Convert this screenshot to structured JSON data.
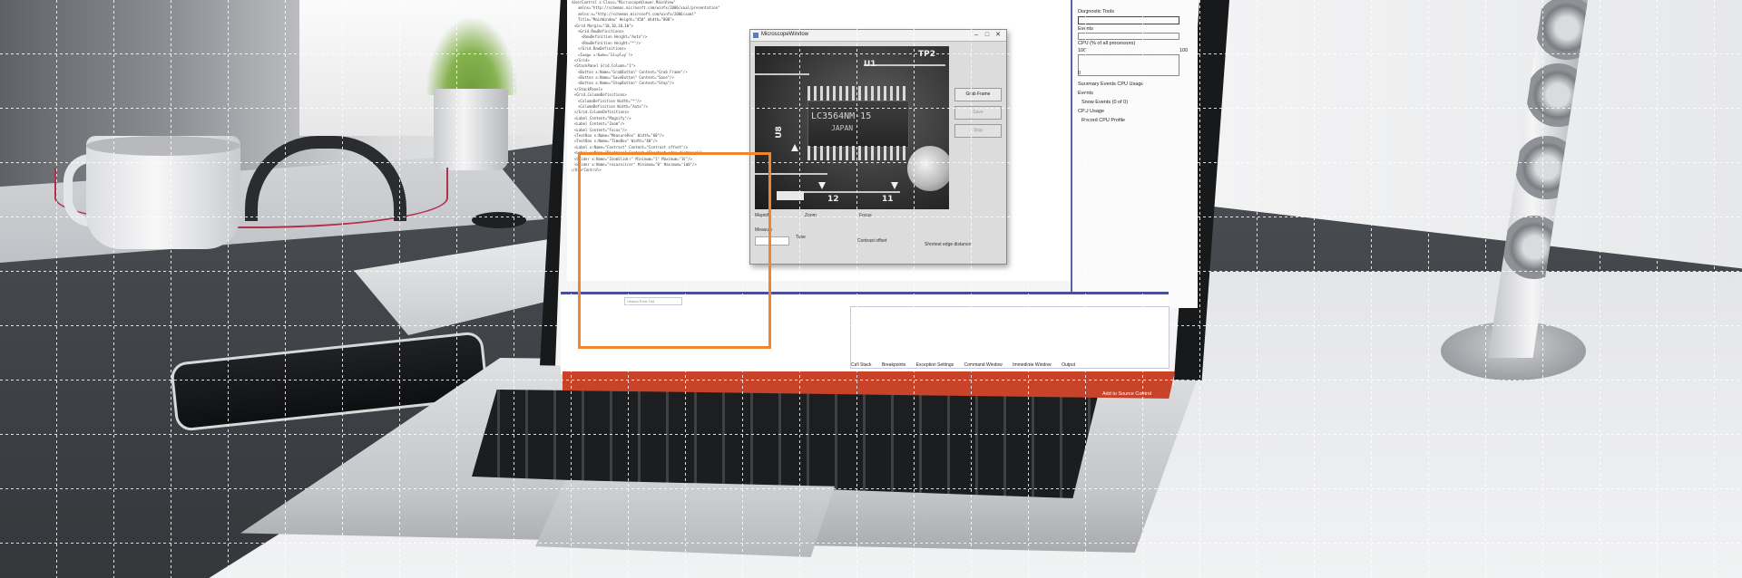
{
  "app_window": {
    "title": "MicroscopeWindow",
    "buttons": {
      "primary": "Grab Frame",
      "secondary": "Save",
      "tertiary": "Stop"
    },
    "labels": {
      "magnify": "Magnify",
      "zoom": "Zoom",
      "focus": "Focus",
      "measure": "Measure",
      "time": "Time",
      "contrast": "Contrast offset",
      "distance": "Shortest edge distance"
    }
  },
  "board_markings": {
    "chip_part": "LC3564NM-15",
    "chip_origin": "JAPAN",
    "tp2": "TP2",
    "ufl": "U8",
    "u3": "U1",
    "label_12": "12",
    "label_11": "11"
  },
  "ide": {
    "code_lines": [
      "<UserControl x:Class=\"MicroscopeViewer.MainView\"",
      "    xmlns=\"http://schemas.microsoft.com/winfx/2006/xaml/presentation\"",
      "    xmlns:x=\"http://schemas.microsoft.com/winfx/2006/xaml\"",
      "    Title=\"MainWindow\" Height=\"450\" Width=\"800\">",
      "  <Grid Margin=\"10,10,10,10\">",
      "    <Grid.RowDefinitions>",
      "      <RowDefinition Height=\"Auto\"/>",
      "      <RowDefinition Height=\"*\"/>",
      "    </Grid.RowDefinitions>",
      "    <Image x:Name=\"Display\"/>",
      "  </Grid>",
      "  <StackPanel Grid.Column=\"1\">",
      "    <Button x:Name=\"GrabButton\" Content=\"Grab Frame\"/>",
      "    <Button x:Name=\"SaveButton\" Content=\"Save\"/>",
      "    <Button x:Name=\"StopButton\" Content=\"Stop\"/>",
      "  </StackPanel>",
      "  <Grid.ColumnDefinitions>",
      "    <ColumnDefinition Width=\"*\"/>",
      "    <ColumnDefinition Width=\"Auto\"/>",
      "  </Grid.ColumnDefinitions>",
      "  <Label Content=\"Magnify\"/>",
      "  <Label Content=\"Zoom\"/>",
      "  <Label Content=\"Focus\"/>",
      "  <TextBox x:Name=\"MeasureBox\" Width=\"60\"/>",
      "  <TextBox x:Name=\"TimeBox\" Width=\"60\"/>",
      "  <Label x:Name=\"Contrast\" Content=\"Contrast offset\"/>",
      "  <Label x:Name=\"Distance\" Content=\"Shortest edge distance\"/>",
      "  <Slider x:Name=\"ZoomSlider\" Minimum=\"1\" Maximum=\"10\"/>",
      "  <Slider x:Name=\"FocusSlider\" Minimum=\"0\" Maximum=\"100\"/>",
      "</UserControl>"
    ],
    "right_panel": {
      "title": "Diagnostic Tools",
      "events": "Events",
      "cpu": "CPU (% of all processors)",
      "cpu_max": "100",
      "cpu_min": "0",
      "summary_tabs": "Summary  Events  CPU Usage",
      "events_item": "Show Events (0 of 0)",
      "cpu_usage": "CPU Usage",
      "record_cpu": "Record CPU Profile"
    },
    "search_placeholder": "Search Error List",
    "bottom_tabs": [
      "Call Stack",
      "Breakpoints",
      "Exception Settings",
      "Command Window",
      "Immediate Window",
      "Output"
    ],
    "source_control": "Add to Source Control"
  },
  "colors": {
    "highlight_box": "#f0862a",
    "ide_accent": "#4a5097",
    "status_bar": "#c9432b"
  }
}
